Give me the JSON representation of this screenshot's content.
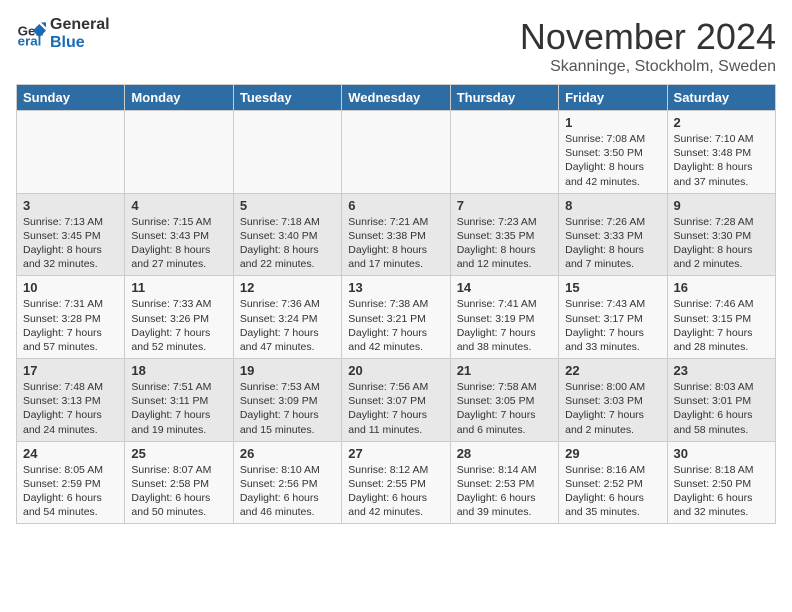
{
  "header": {
    "logo_line1": "General",
    "logo_line2": "Blue",
    "month": "November 2024",
    "location": "Skanninge, Stockholm, Sweden"
  },
  "weekdays": [
    "Sunday",
    "Monday",
    "Tuesday",
    "Wednesday",
    "Thursday",
    "Friday",
    "Saturday"
  ],
  "weeks": [
    [
      {
        "day": "",
        "info": ""
      },
      {
        "day": "",
        "info": ""
      },
      {
        "day": "",
        "info": ""
      },
      {
        "day": "",
        "info": ""
      },
      {
        "day": "",
        "info": ""
      },
      {
        "day": "1",
        "info": "Sunrise: 7:08 AM\nSunset: 3:50 PM\nDaylight: 8 hours\nand 42 minutes."
      },
      {
        "day": "2",
        "info": "Sunrise: 7:10 AM\nSunset: 3:48 PM\nDaylight: 8 hours\nand 37 minutes."
      }
    ],
    [
      {
        "day": "3",
        "info": "Sunrise: 7:13 AM\nSunset: 3:45 PM\nDaylight: 8 hours\nand 32 minutes."
      },
      {
        "day": "4",
        "info": "Sunrise: 7:15 AM\nSunset: 3:43 PM\nDaylight: 8 hours\nand 27 minutes."
      },
      {
        "day": "5",
        "info": "Sunrise: 7:18 AM\nSunset: 3:40 PM\nDaylight: 8 hours\nand 22 minutes."
      },
      {
        "day": "6",
        "info": "Sunrise: 7:21 AM\nSunset: 3:38 PM\nDaylight: 8 hours\nand 17 minutes."
      },
      {
        "day": "7",
        "info": "Sunrise: 7:23 AM\nSunset: 3:35 PM\nDaylight: 8 hours\nand 12 minutes."
      },
      {
        "day": "8",
        "info": "Sunrise: 7:26 AM\nSunset: 3:33 PM\nDaylight: 8 hours\nand 7 minutes."
      },
      {
        "day": "9",
        "info": "Sunrise: 7:28 AM\nSunset: 3:30 PM\nDaylight: 8 hours\nand 2 minutes."
      }
    ],
    [
      {
        "day": "10",
        "info": "Sunrise: 7:31 AM\nSunset: 3:28 PM\nDaylight: 7 hours\nand 57 minutes."
      },
      {
        "day": "11",
        "info": "Sunrise: 7:33 AM\nSunset: 3:26 PM\nDaylight: 7 hours\nand 52 minutes."
      },
      {
        "day": "12",
        "info": "Sunrise: 7:36 AM\nSunset: 3:24 PM\nDaylight: 7 hours\nand 47 minutes."
      },
      {
        "day": "13",
        "info": "Sunrise: 7:38 AM\nSunset: 3:21 PM\nDaylight: 7 hours\nand 42 minutes."
      },
      {
        "day": "14",
        "info": "Sunrise: 7:41 AM\nSunset: 3:19 PM\nDaylight: 7 hours\nand 38 minutes."
      },
      {
        "day": "15",
        "info": "Sunrise: 7:43 AM\nSunset: 3:17 PM\nDaylight: 7 hours\nand 33 minutes."
      },
      {
        "day": "16",
        "info": "Sunrise: 7:46 AM\nSunset: 3:15 PM\nDaylight: 7 hours\nand 28 minutes."
      }
    ],
    [
      {
        "day": "17",
        "info": "Sunrise: 7:48 AM\nSunset: 3:13 PM\nDaylight: 7 hours\nand 24 minutes."
      },
      {
        "day": "18",
        "info": "Sunrise: 7:51 AM\nSunset: 3:11 PM\nDaylight: 7 hours\nand 19 minutes."
      },
      {
        "day": "19",
        "info": "Sunrise: 7:53 AM\nSunset: 3:09 PM\nDaylight: 7 hours\nand 15 minutes."
      },
      {
        "day": "20",
        "info": "Sunrise: 7:56 AM\nSunset: 3:07 PM\nDaylight: 7 hours\nand 11 minutes."
      },
      {
        "day": "21",
        "info": "Sunrise: 7:58 AM\nSunset: 3:05 PM\nDaylight: 7 hours\nand 6 minutes."
      },
      {
        "day": "22",
        "info": "Sunrise: 8:00 AM\nSunset: 3:03 PM\nDaylight: 7 hours\nand 2 minutes."
      },
      {
        "day": "23",
        "info": "Sunrise: 8:03 AM\nSunset: 3:01 PM\nDaylight: 6 hours\nand 58 minutes."
      }
    ],
    [
      {
        "day": "24",
        "info": "Sunrise: 8:05 AM\nSunset: 2:59 PM\nDaylight: 6 hours\nand 54 minutes."
      },
      {
        "day": "25",
        "info": "Sunrise: 8:07 AM\nSunset: 2:58 PM\nDaylight: 6 hours\nand 50 minutes."
      },
      {
        "day": "26",
        "info": "Sunrise: 8:10 AM\nSunset: 2:56 PM\nDaylight: 6 hours\nand 46 minutes."
      },
      {
        "day": "27",
        "info": "Sunrise: 8:12 AM\nSunset: 2:55 PM\nDaylight: 6 hours\nand 42 minutes."
      },
      {
        "day": "28",
        "info": "Sunrise: 8:14 AM\nSunset: 2:53 PM\nDaylight: 6 hours\nand 39 minutes."
      },
      {
        "day": "29",
        "info": "Sunrise: 8:16 AM\nSunset: 2:52 PM\nDaylight: 6 hours\nand 35 minutes."
      },
      {
        "day": "30",
        "info": "Sunrise: 8:18 AM\nSunset: 2:50 PM\nDaylight: 6 hours\nand 32 minutes."
      }
    ]
  ]
}
